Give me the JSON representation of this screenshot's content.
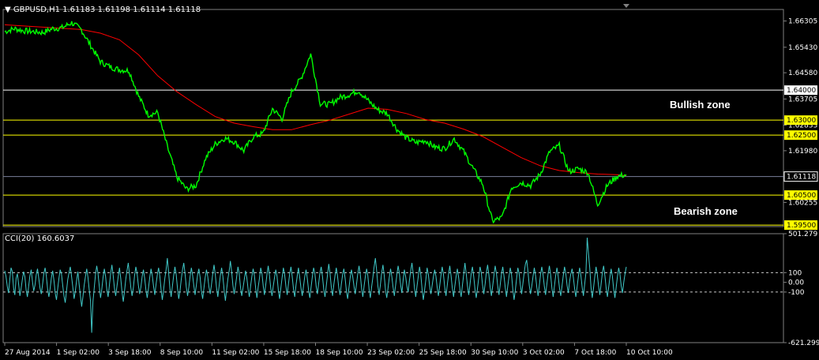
{
  "window": {
    "symbol_header": "GBPUSD,H1  1.61183 1.61198 1.61114 1.61118",
    "indicator_header": "CCI(20) 160.6037"
  },
  "annotations": {
    "bullish": "Bullish zone",
    "bearish": "Bearish zone"
  },
  "colors": {
    "background": "#000000",
    "price_line": "#00ff00",
    "moving_average": "#ff0000",
    "resistance_level": "#ffffff",
    "support_level": "#ffff00",
    "cci_line": "#40c8c8",
    "axis_text": "#ffffff"
  },
  "chart_data": [
    {
      "type": "line",
      "title": "GBPUSD,H1",
      "x_labels": [
        "27 Aug 2014",
        "1 Sep 02:00",
        "3 Sep 18:00",
        "8 Sep 10:00",
        "11 Sep 02:00",
        "15 Sep 18:00",
        "18 Sep 10:00",
        "23 Sep 02:00",
        "25 Sep 18:00",
        "30 Sep 10:00",
        "3 Oct 02:00",
        "7 Oct 18:00",
        "10 Oct 10:00"
      ],
      "y_ticks": [
        1.66305,
        1.6543,
        1.6458,
        1.63705,
        1.62833,
        1.6198,
        1.60255
      ],
      "ylim": [
        1.5945,
        1.6669
      ],
      "current_price": 1.61118,
      "price_series": {
        "name": "GBPUSD close (approx.)",
        "x": [
          0,
          1,
          2,
          3,
          4,
          5,
          6,
          7,
          8,
          9,
          10,
          11,
          12,
          13,
          14,
          15,
          16,
          17,
          18,
          19,
          20,
          21,
          22,
          23,
          24,
          25,
          26,
          27,
          28,
          29,
          30,
          31,
          32,
          33,
          34,
          35,
          36,
          37,
          38,
          39,
          40,
          41,
          42,
          43,
          44,
          45,
          46,
          47,
          48,
          49,
          50,
          51,
          52,
          53,
          54,
          55,
          56,
          57,
          58,
          59,
          60,
          61,
          62,
          63,
          64,
          65
        ],
        "values": [
          1.6595,
          1.6605,
          1.6598,
          1.6595,
          1.6592,
          1.6605,
          1.6608,
          1.6625,
          1.6602,
          1.6548,
          1.6495,
          1.6478,
          1.6468,
          1.6465,
          1.638,
          1.6318,
          1.6325,
          1.6212,
          1.611,
          1.607,
          1.6082,
          1.6172,
          1.622,
          1.624,
          1.6228,
          1.6198,
          1.6245,
          1.6255,
          1.6338,
          1.6305,
          1.6395,
          1.644,
          1.652,
          1.6355,
          1.6352,
          1.6375,
          1.6385,
          1.6398,
          1.6365,
          1.6335,
          1.6322,
          1.627,
          1.624,
          1.6225,
          1.6232,
          1.621,
          1.6205,
          1.6238,
          1.6195,
          1.6138,
          1.6085,
          1.5963,
          1.5975,
          1.6075,
          1.6092,
          1.6082,
          1.612,
          1.6195,
          1.6215,
          1.6128,
          1.6138,
          1.6125,
          1.6018,
          1.6082,
          1.6112,
          1.6118
        ]
      },
      "moving_average": {
        "name": "Moving average",
        "x": [
          0,
          4,
          8,
          10,
          12,
          14,
          16,
          18,
          20,
          22,
          24,
          26,
          28,
          30,
          32,
          34,
          36,
          38,
          40,
          42,
          44,
          46,
          48,
          50,
          52,
          54,
          56,
          58,
          60,
          62,
          64,
          65
        ],
        "values": [
          1.6618,
          1.661,
          1.6602,
          1.659,
          1.6568,
          1.6518,
          1.6448,
          1.6395,
          1.6352,
          1.6312,
          1.629,
          1.6278,
          1.6268,
          1.6268,
          1.6285,
          1.63,
          1.632,
          1.634,
          1.6336,
          1.6322,
          1.6302,
          1.629,
          1.627,
          1.6245,
          1.621,
          1.6175,
          1.6148,
          1.6132,
          1.6125,
          1.612,
          1.6118,
          1.6114
        ]
      },
      "levels": [
        {
          "value": 1.64,
          "label": "1.64000",
          "style": "resistance"
        },
        {
          "value": 1.63,
          "label": "1.63000",
          "style": "support"
        },
        {
          "value": 1.625,
          "label": "1.62500",
          "style": "support"
        },
        {
          "value": 1.605,
          "label": "1.60500",
          "style": "support"
        },
        {
          "value": 1.595,
          "label": "1.59500",
          "style": "support"
        }
      ],
      "grid": false
    },
    {
      "type": "line",
      "title": "CCI(20)",
      "y_ticks": [
        501.279,
        100,
        0.0,
        -100,
        -621.2994
      ],
      "y_tick_labels": [
        "501.279",
        "100",
        "0.00",
        "-100",
        "-621.2994"
      ],
      "ylim": [
        -621.2994,
        501.279
      ],
      "reference_lines": [
        100,
        -100
      ],
      "current_value": 160.6037,
      "series": {
        "name": "CCI(20)",
        "values": [
          120,
          60,
          -40,
          -110,
          30,
          150,
          110,
          -60,
          -130,
          40,
          90,
          -20,
          -140,
          -60,
          30,
          110,
          60,
          -80,
          -150,
          -40,
          70,
          130,
          10,
          -90,
          -30,
          80,
          140,
          40,
          -60,
          -120,
          -20,
          90,
          150,
          60,
          -70,
          -150,
          -60,
          50,
          120,
          20,
          -110,
          -180,
          -70,
          40,
          130,
          90,
          -30,
          -140,
          -210,
          -90,
          30,
          100,
          160,
          60,
          -50,
          -170,
          -90,
          20,
          110,
          -20,
          -140,
          -250,
          -150,
          -30,
          60,
          140,
          50,
          -80,
          -190,
          -520,
          -200,
          -60,
          80,
          170,
          90,
          -40,
          -160,
          -70,
          50,
          140,
          60,
          -80,
          -150,
          -30,
          90,
          180,
          70,
          -60,
          -140,
          -40,
          60,
          150,
          40,
          -100,
          -200,
          -90,
          30,
          120,
          200,
          80,
          -50,
          -140,
          -60,
          70,
          160,
          90,
          -30,
          -120,
          -50,
          60,
          130,
          40,
          -80,
          -160,
          -60,
          50,
          140,
          70,
          -40,
          -130,
          -20,
          80,
          150,
          60,
          -70,
          -180,
          -80,
          40,
          130,
          250,
          100,
          -60,
          -150,
          -40,
          70,
          160,
          80,
          -60,
          -170,
          -90,
          30,
          130,
          200,
          90,
          -50,
          -140,
          -50,
          60,
          150,
          70,
          -40,
          -130,
          -30,
          80,
          140,
          50,
          -90,
          -170,
          -60,
          50,
          130,
          60,
          -50,
          -120,
          -20,
          90,
          180,
          80,
          -60,
          -150,
          -40,
          70,
          150,
          60,
          -80,
          -190,
          -70,
          40,
          120,
          220,
          110,
          -30,
          -120,
          -40,
          60,
          160,
          90,
          -50,
          -140,
          -60,
          30,
          120,
          50,
          -70,
          -150,
          -40,
          60,
          140,
          70,
          -60,
          -160,
          -50,
          40,
          150,
          90,
          -40,
          -130,
          -30,
          80,
          170,
          70,
          -60,
          -140,
          -40,
          50,
          130,
          60,
          -80,
          -170,
          -60,
          50,
          150,
          80,
          -40,
          -130,
          -20,
          90,
          160,
          60,
          -70,
          -150,
          -30,
          70,
          150,
          50,
          -60,
          -140,
          -40,
          60,
          130,
          40,
          -80,
          -160,
          -50,
          60,
          150,
          90,
          -40,
          -120,
          -10,
          100,
          160,
          60,
          -70,
          -150,
          -40,
          80,
          190,
          90,
          -50,
          -140,
          -30,
          70,
          150,
          60,
          -60,
          -130,
          -20,
          80,
          140,
          40,
          -90,
          -170,
          -60,
          50,
          130,
          60,
          -40,
          -120,
          -20,
          90,
          170,
          80,
          -60,
          -150,
          -40,
          60,
          140,
          70,
          -70,
          -160,
          -50,
          50,
          160,
          250,
          120,
          -40,
          -130,
          -20,
          100,
          180,
          70,
          -80,
          -160,
          -60,
          50,
          140,
          60,
          -50,
          -140,
          -30,
          80,
          170,
          90,
          -30,
          -110,
          20,
          130,
          60,
          -40,
          -100,
          20,
          120,
          200,
          90,
          -60,
          -150,
          -40,
          60,
          160,
          80,
          -70,
          -180,
          -80,
          30,
          150,
          80,
          -40,
          -120,
          -30,
          60,
          130,
          60,
          -50,
          -140,
          -40,
          70,
          160,
          80,
          -50,
          -140,
          -30,
          80,
          170,
          70,
          -60,
          -150,
          -40,
          60,
          140,
          50,
          -70,
          -150,
          -30,
          80,
          200,
          90,
          -40,
          -130,
          -20,
          90,
          160,
          60,
          -70,
          -160,
          -60,
          50,
          160,
          100,
          -30,
          -120,
          -20,
          100,
          180,
          80,
          -50,
          -140,
          -40,
          70,
          170,
          90,
          -40,
          -130,
          -20,
          90,
          160,
          60,
          -60,
          -150,
          -40,
          60,
          150,
          80,
          -70,
          -180,
          -80,
          40,
          150,
          90,
          -30,
          -120,
          -10,
          100,
          190,
          230,
          110,
          -30,
          -120,
          -40,
          60,
          150,
          70,
          -50,
          -140,
          -30,
          80,
          160,
          80,
          -40,
          -130,
          -20,
          90,
          170,
          80,
          -60,
          -150,
          -40,
          70,
          150,
          60,
          -60,
          -140,
          -40,
          70,
          160,
          90,
          -30,
          -110,
          10,
          90,
          140,
          50,
          -60,
          -150,
          -50,
          60,
          150,
          70,
          -50,
          -140,
          -20,
          100,
          460,
          300,
          150,
          -50,
          -160,
          -60,
          60,
          160,
          80,
          -40,
          -130,
          -20,
          100,
          170,
          70,
          -60,
          -150,
          -50,
          50,
          140,
          60,
          -70,
          -160,
          -50,
          60,
          150,
          80,
          -40,
          -110,
          0,
          90,
          160
        ]
      }
    }
  ]
}
